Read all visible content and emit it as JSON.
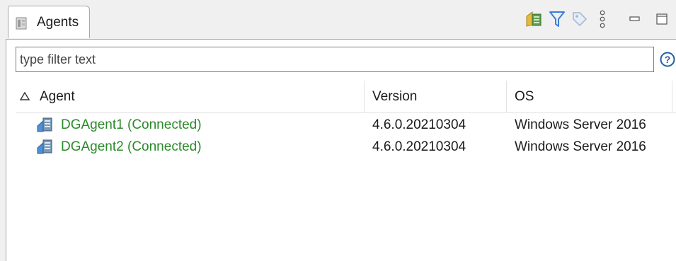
{
  "view": {
    "tab_label": "Agents",
    "toolbar": {
      "icons": [
        "add-agent-icon",
        "filter-icon",
        "tag-icon",
        "view-menu-icon",
        "minimize-icon",
        "maximize-icon"
      ]
    },
    "filter": {
      "placeholder": "type filter text",
      "value": ""
    }
  },
  "table": {
    "columns": [
      "Agent",
      "Version",
      "OS"
    ],
    "sort_indicator": "Δ",
    "rows": [
      {
        "agent": "DGAgent1 (Connected)",
        "version": "4.6.0.20210304",
        "os": "Windows Server 2016"
      },
      {
        "agent": "DGAgent2 (Connected)",
        "version": "4.6.0.20210304",
        "os": "Windows Server 2016"
      }
    ]
  },
  "colors": {
    "connected": "#2a8a2a",
    "filter_icon": "#3a7dd8",
    "border": "#a8a8a8"
  }
}
